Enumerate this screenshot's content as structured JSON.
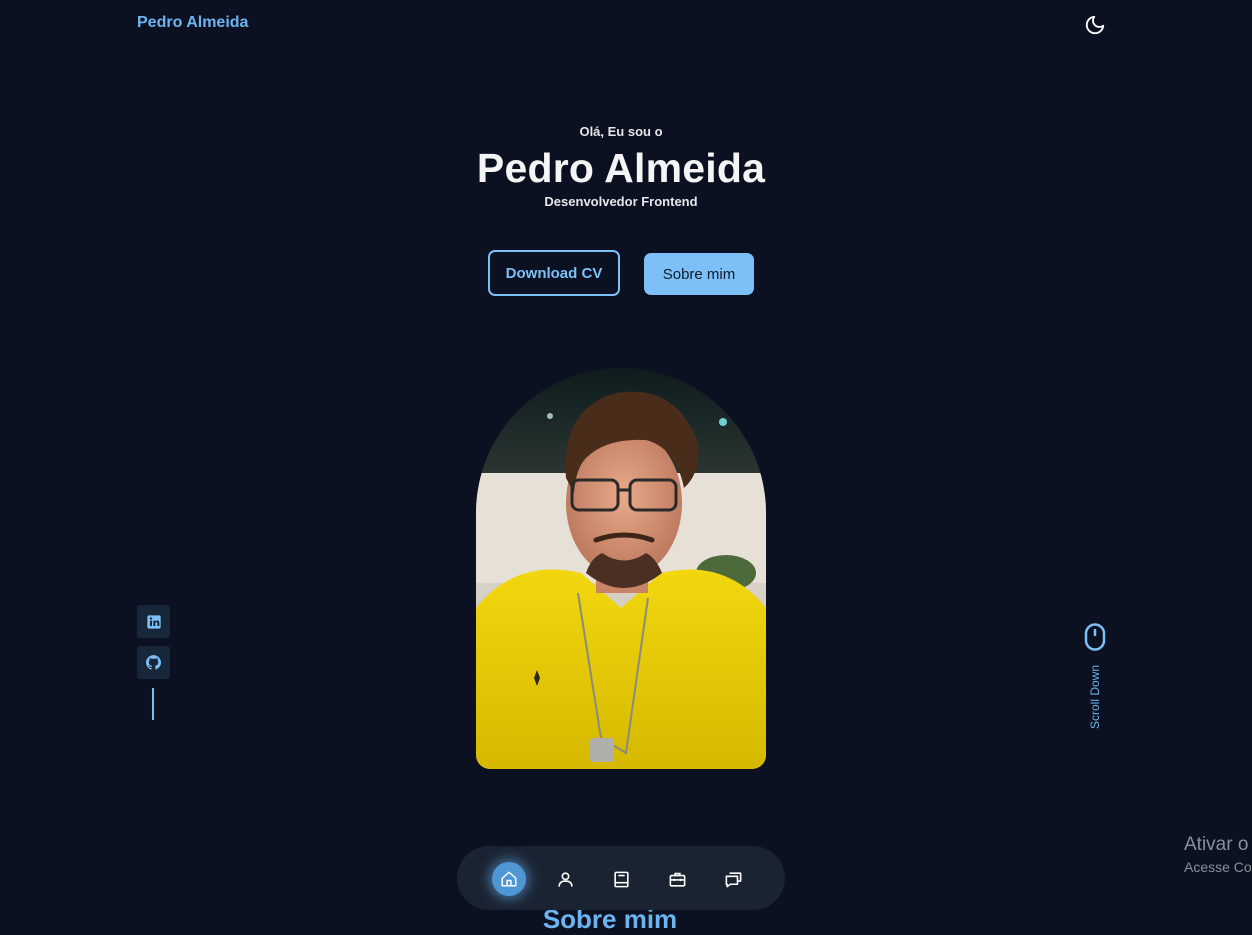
{
  "header": {
    "logo": "Pedro Almeida"
  },
  "hero": {
    "greeting": "Olá, Eu sou o",
    "name": "Pedro Almeida",
    "role": "Desenvolvedor Frontend",
    "buttons": {
      "download_cv": "Download CV",
      "about_me": "Sobre mim"
    }
  },
  "scroll": {
    "label": "Scroll Down"
  },
  "next_section": {
    "heading_peek": "Sobre mim"
  },
  "watermark": {
    "title": "Ativar o",
    "subtitle": "Acesse Co"
  },
  "colors": {
    "background": "#0b1120",
    "accent": "#7cc0f7",
    "nav_background": "#1a2332"
  },
  "icons": {
    "theme": "moon-icon",
    "social": [
      "linkedin-icon",
      "github-icon"
    ],
    "scroll": "mouse-icon",
    "nav": [
      "home-icon",
      "user-icon",
      "book-icon",
      "briefcase-icon",
      "chat-icon"
    ]
  },
  "bottom_nav": {
    "active_index": 0
  }
}
